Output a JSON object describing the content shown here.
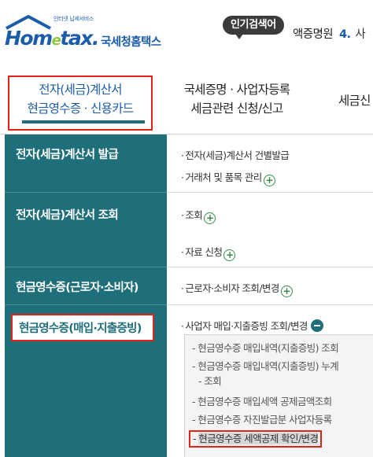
{
  "header": {
    "logo_tag": "인터넷 납세서비스",
    "logo_word_a": "Hom",
    "logo_word_e": "e",
    "logo_word_b": "tax.",
    "site_name": "국세청홈택스",
    "popular_badge": "인기검색어",
    "ticker_term": "액증명원",
    "ticker_num": "4.",
    "ticker_more": "사"
  },
  "nav": {
    "tabs": [
      {
        "line1": "전자(세금)계산서",
        "line2": "현금영수증 · 신용카드"
      },
      {
        "line1": "국세증명 · 사업자등록",
        "line2": "세금관련 신청/신고"
      },
      {
        "line1": "세금신"
      }
    ]
  },
  "menu": {
    "categories": [
      "전자(세금)계산서 발급",
      "전자(세금)계산서 조회",
      "현금영수증(근로자·소비자)",
      "현금영수증(매입·지출증빙)"
    ],
    "items": {
      "issue_1": "전자(세금)계산서 건별발급",
      "issue_2": "거래처 및 품목 관리",
      "query_1": "조회",
      "query_2": "자료 신청",
      "consumer_1": "근로자·소비자 조회/변경",
      "business_1": "사업자 매입·지출증빙 조회/변경"
    },
    "submenu": [
      "현금영수증 매입내역(지출증빙) 조회",
      "현금영수증 매입내역(지출증빙) 누계",
      "조회",
      "현금영수증 매입세액 공제금액조회",
      "현금영수증 자진발급분 사업자등록",
      "현금영수증 세액공제 확인/변경"
    ]
  },
  "colors": {
    "brand_blue": "#1b5cab",
    "teal": "#1f6f7a",
    "highlight_red": "#e2231a",
    "plus_green": "#3a8a4a"
  },
  "icons": {
    "plus": "plus-circle-icon",
    "minus": "minus-circle-icon",
    "house": "house-logo-icon"
  }
}
